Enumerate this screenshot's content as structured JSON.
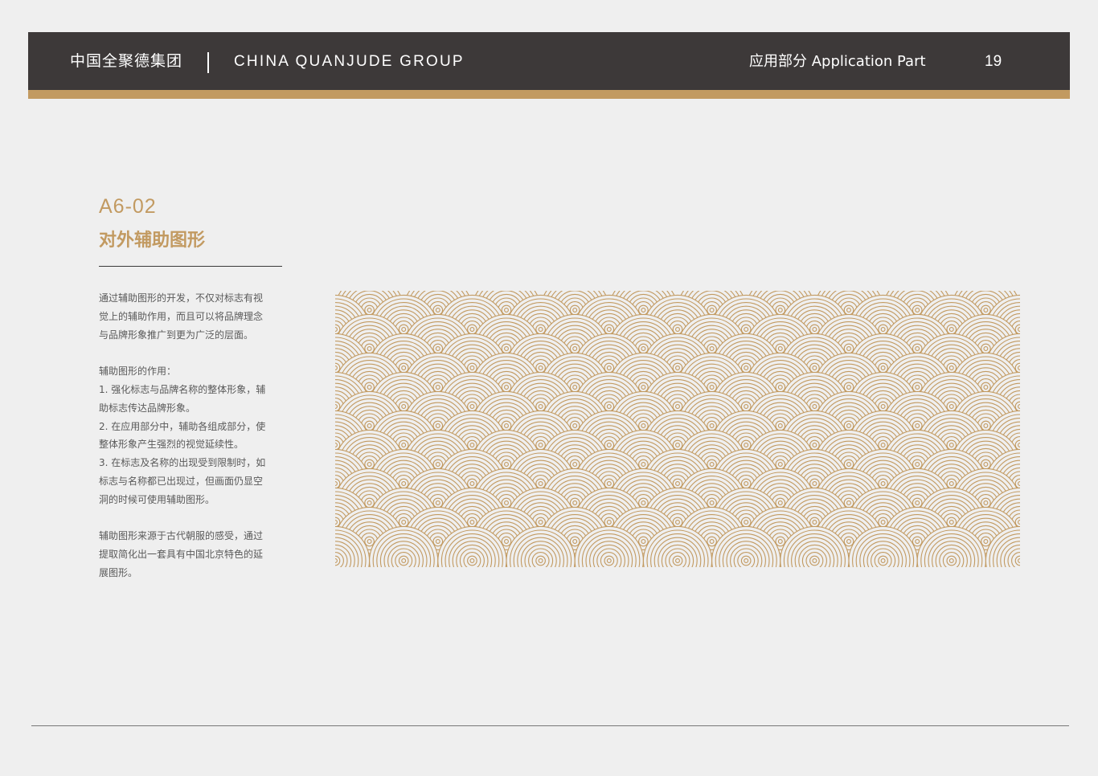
{
  "header": {
    "brand_cn": "中国全聚德集团",
    "brand_en": "CHINA QUANJUDE GROUP",
    "section": "应用部分  Application Part",
    "page_number": "19"
  },
  "section": {
    "code": "A6-02",
    "title": "对外辅助图形"
  },
  "description": {
    "intro": "通过辅助图形的开发，不仅对标志有视\n觉上的辅助作用，而且可以将品牌理念\n与品牌形象推广到更为广泛的层面。",
    "roles_heading": "辅助图形的作用：",
    "role_1": "1. 强化标志与品牌名称的整体形象，辅\n助标志传达品牌形象。",
    "role_2": "2. 在应用部分中，辅助各组成部分，使\n整体形象产生强烈的视觉延续性。",
    "role_3": "3. 在标志及名称的出现受到限制时，如\n标志与名称都已出现过，但画面仍显空\n洞的时候可使用辅助图形。",
    "origin": "辅助图形来源于古代朝服的感受，通过\n提取简化出一套具有中国北京特色的延\n展图形。"
  },
  "pattern": {
    "name": "wave-pattern",
    "color": "#c29a61",
    "columns": 10,
    "rows": 14
  },
  "colors": {
    "header_bg": "#3d3939",
    "accent": "#c29a61",
    "page_bg": "#efefef",
    "body_text": "#595959"
  }
}
